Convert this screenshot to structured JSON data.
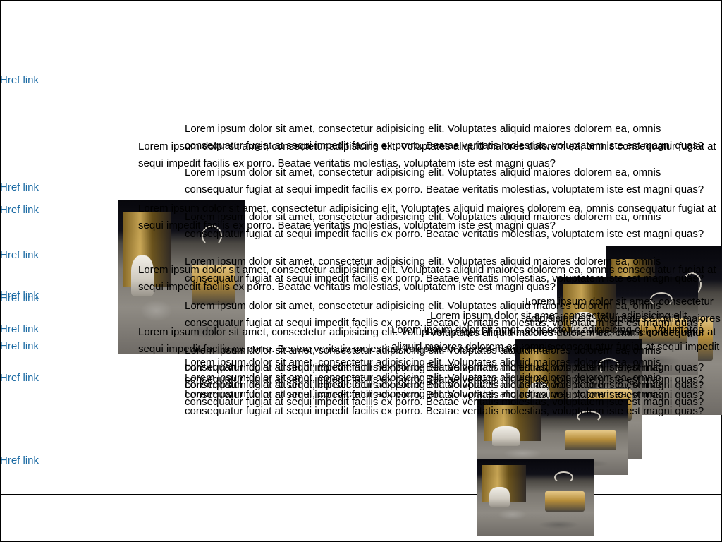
{
  "links": [
    "Href link",
    "Href link",
    "Href link",
    "Href link",
    "Href link",
    "Href link",
    "Href link",
    "Href link",
    "Href link",
    "Href link"
  ],
  "paragraphs": [
    "Lorem ipsum dolor sit amet, consectetur adipisicing elit. Voluptates aliquid maiores dolorem ea, omnis consequatur fugiat at sequi impedit facilis ex porro. Beatae veritatis molestias, voluptatem iste est magni quas?",
    "Lorem ipsum dolor sit amet, consectetur adipisicing elit. Voluptates aliquid maiores dolorem ea, omnis consequatur fugiat at sequi impedit facilis ex porro. Beatae veritatis molestias, voluptatem iste est magni quas?",
    "Lorem ipsum dolor sit amet, consectetur adipisicing elit. Voluptates aliquid maiores dolorem ea, omnis consequatur fugiat at sequi impedit facilis ex porro. Beatae veritatis molestias, voluptatem iste est magni quas?",
    "Lorem ipsum dolor sit amet, consectetur adipisicing elit. Voluptates aliquid maiores dolorem ea, omnis consequatur fugiat at sequi impedit facilis ex porro. Beatae veritatis molestias, voluptatem iste est magni quas?",
    "Lorem ipsum dolor sit amet, consectetur adipisicing elit. Voluptates aliquid maiores dolorem ea, omnis consequatur fugiat at sequi impedit facilis ex porro. Beatae veritatis molestias, voluptatem iste est magni quas?",
    "Lorem ipsum dolor sit amet, consectetur adipisicing elit. Voluptates aliquid maiores dolorem ea, omnis consequatur fugiat at sequi impedit facilis ex porro. Beatae veritatis molestias, voluptatem iste est magni quas?",
    "Lorem ipsum dolor sit amet, consectetur adipisicing elit. Voluptates aliquid maiores dolorem ea, omnis consequatur fugiat at sequi impedit facilis ex porro. Beatae veritatis molestias, voluptatem iste est magni quas?",
    "Lorem ipsum dolor sit amet, consectetur adipisicing elit. Voluptates aliquid maiores dolorem ea, omnis consequatur fugiat at sequi impedit facilis ex porro. Beatae veritatis molestias, voluptatem iste est magni quas?",
    "Lorem ipsum dolor sit amet, consectetur adipisicing elit. Voluptates aliquid maiores dolorem ea, omnis consequatur fugiat at sequi impedit facilis ex porro. Beatae veritatis molestias, voluptatem iste est magni quas?",
    "Lorem ipsum dolor sit amet, consectetur adipisicing elit. Voluptates aliquid maiores dolorem ea, omnis consequatur fugiat at sequi impedit facilis ex porro. Beatae veritatis molestias, voluptatem iste est magni quas?",
    "Lorem ipsum dolor sit amet, consectetur adipisicing elit. Voluptates aliquid maiores dolorem ea, omnis consequatur fugiat at sequi impedit facilis ex porro. Beatae veritatis molestias, voluptatem iste est magni quas?",
    "Lorem ipsum dolor sit amet, consectetur adipisicing elit. Voluptates aliquid maiores dolorem ea, omnis consequatur fugiat at sequi impedit facilis ex porro. Beatae veritatis molestias, voluptatem iste est magni quas?",
    "Lorem ipsum dolor sit amet, consectetur adipisicing elit. Voluptates aliquid maiores dolorem ea, omnis consequatur fugiat at sequi impedit facilis ex porro. Beatae veritatis molestias, voluptatem iste est magni quas?",
    "Lorem ipsum dolor sit amet, consectetur adipisicing elit. Voluptates aliquid maiores dolorem ea, omnis consequatur fugiat at sequi impedit facilis ex porro. Beatae veritatis molestias, voluptatem iste est magni quas?",
    "Lorem ipsum dolor sit amet, consectetur adipisicing elit. Voluptates aliquid maiores dolorem ea, omnis consequatur fugiat at sequi impedit facilis ex porro. Beatae veritatis molestias, voluptatem iste est magni quas?",
    "Lorem ipsum dolor sit amet, consectetur adipisicing elit. Voluptates aliquid maiores dolorem ea, omnis consequatur fugiat at sequi impedit facilis ex porro. Beatae veritatis molestias, voluptatem iste est magni quas?",
    "Lorem ipsum dolor sit amet, consectetur adipisicing elit. Voluptates aliquid maiores dolorem ea, omnis consequatur fugiat at sequi impedit facilis ex porro. Beatae veritatis molestias, voluptatem iste est magni quas?",
    "Lorem ipsum dolor sit amet, consectetur adipisicing elit. Voluptates aliquid maiores dolorem ea, omnis consequatur fugiat at sequi impedit facilis ex porro. Beatae veritatis molestias, voluptatem iste est magni quas?"
  ],
  "colors": {
    "link": "#1a6aa3",
    "text": "#000000",
    "rule": "#000000"
  }
}
